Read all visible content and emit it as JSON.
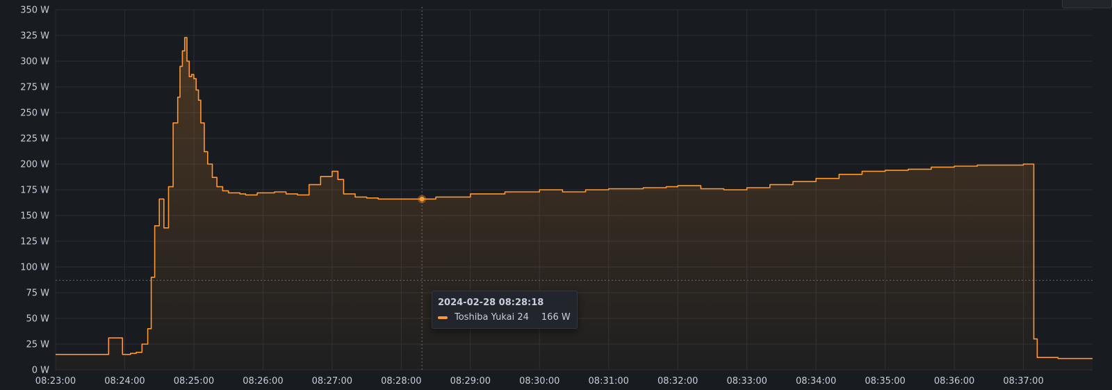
{
  "chart_data": {
    "type": "area",
    "xlabel": "",
    "ylabel": "",
    "x_tick_labels": [
      "08:23:00",
      "08:24:00",
      "08:25:00",
      "08:26:00",
      "08:27:00",
      "08:28:00",
      "08:29:00",
      "08:30:00",
      "08:31:00",
      "08:32:00",
      "08:33:00",
      "08:34:00",
      "08:35:00",
      "08:36:00",
      "08:37:00"
    ],
    "y_tick_labels": [
      "0 W",
      "25 W",
      "50 W",
      "75 W",
      "100 W",
      "125 W",
      "150 W",
      "175 W",
      "200 W",
      "225 W",
      "250 W",
      "275 W",
      "300 W",
      "325 W",
      "350 W"
    ],
    "xlim": [
      "08:23:00",
      "08:38:00"
    ],
    "ylim": [
      0,
      350
    ],
    "grid": true,
    "crosshair": {
      "x": "08:28:18",
      "y": 87
    },
    "series": [
      {
        "name": "Toshiba Yukai 24",
        "color": "#ff9830",
        "x": [
          "08:23:00",
          "08:23:45",
          "08:23:46",
          "08:23:57",
          "08:23:58",
          "08:24:05",
          "08:24:10",
          "08:24:15",
          "08:24:20",
          "08:24:23",
          "08:24:26",
          "08:24:30",
          "08:24:34",
          "08:24:38",
          "08:24:42",
          "08:24:46",
          "08:24:48",
          "08:24:50",
          "08:24:52",
          "08:24:54",
          "08:24:56",
          "08:24:58",
          "08:25:00",
          "08:25:02",
          "08:25:04",
          "08:25:06",
          "08:25:09",
          "08:25:12",
          "08:25:16",
          "08:25:20",
          "08:25:25",
          "08:25:30",
          "08:25:35",
          "08:25:40",
          "08:25:45",
          "08:25:50",
          "08:25:55",
          "08:26:00",
          "08:26:10",
          "08:26:20",
          "08:26:30",
          "08:26:40",
          "08:26:50",
          "08:27:00",
          "08:27:05",
          "08:27:10",
          "08:27:20",
          "08:27:30",
          "08:27:40",
          "08:27:50",
          "08:28:00",
          "08:28:18",
          "08:28:30",
          "08:29:00",
          "08:29:30",
          "08:30:00",
          "08:30:20",
          "08:30:40",
          "08:31:00",
          "08:31:30",
          "08:31:50",
          "08:32:00",
          "08:32:20",
          "08:32:40",
          "08:33:00",
          "08:33:20",
          "08:33:40",
          "08:34:00",
          "08:34:20",
          "08:34:40",
          "08:35:00",
          "08:35:20",
          "08:35:40",
          "08:36:00",
          "08:36:20",
          "08:36:40",
          "08:37:00",
          "08:37:08",
          "08:37:09",
          "08:37:12",
          "08:37:30",
          "08:38:00"
        ],
        "values": [
          15,
          15,
          31,
          31,
          15,
          16,
          17,
          25,
          40,
          90,
          140,
          166,
          138,
          178,
          240,
          265,
          295,
          310,
          323,
          300,
          285,
          287,
          283,
          272,
          262,
          240,
          212,
          200,
          187,
          178,
          174,
          172,
          172,
          171,
          170,
          170,
          172,
          172,
          173,
          171,
          170,
          180,
          188,
          193,
          185,
          171,
          168,
          167,
          166,
          166,
          166,
          166,
          168,
          171,
          173,
          175,
          173,
          175,
          176,
          177,
          178,
          179,
          176,
          175,
          177,
          180,
          183,
          186,
          190,
          193,
          194,
          195,
          197,
          198,
          199,
          199,
          200,
          200,
          30,
          12,
          11,
          11
        ]
      }
    ]
  },
  "tooltip": {
    "time": "2024-02-28 08:28:18",
    "series_name": "Toshiba Yukai 24",
    "value": "166 W",
    "color": "#ff9830"
  },
  "colors": {
    "background": "#181b1f",
    "grid": "#2b2e33",
    "axis_text": "#ccccdc",
    "series": "#ff9830"
  }
}
